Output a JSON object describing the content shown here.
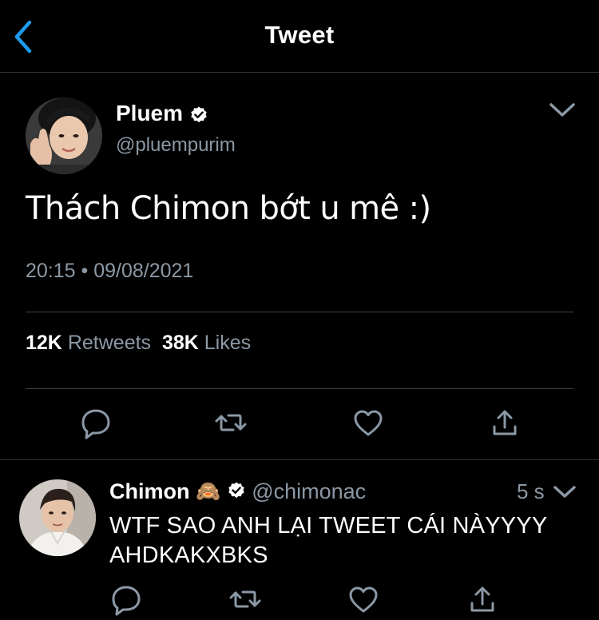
{
  "header": {
    "title": "Tweet",
    "back_icon": "chevron-left-icon",
    "accent_color": "#1d9bf0"
  },
  "tweet": {
    "author_name": "Pluem",
    "author_handle": "@pluempurim",
    "verified_icon": "verified-badge-icon",
    "text": "Thách Chimon bớt u mê :)",
    "timestamp": "20:15 • 09/08/2021",
    "stats": {
      "retweets_count": "12K",
      "retweets_label": "Retweets",
      "likes_count": "38K",
      "likes_label": "Likes"
    },
    "actions": [
      "reply-icon",
      "retweet-icon",
      "like-icon",
      "share-icon"
    ]
  },
  "reply": {
    "author_name": "Chimon",
    "emoji": "🙈",
    "author_handle": "@chimonac",
    "time": "5 s",
    "text": "WTF SAO ANH LẠI TWEET CÁI NÀYYYY AHDKAKXBKS",
    "actions": [
      "reply-icon",
      "retweet-icon",
      "like-icon",
      "share-icon"
    ]
  },
  "colors": {
    "background": "#000000",
    "text": "#ffffff",
    "secondary_text": "#8b98a5",
    "divider": "#38444d"
  }
}
